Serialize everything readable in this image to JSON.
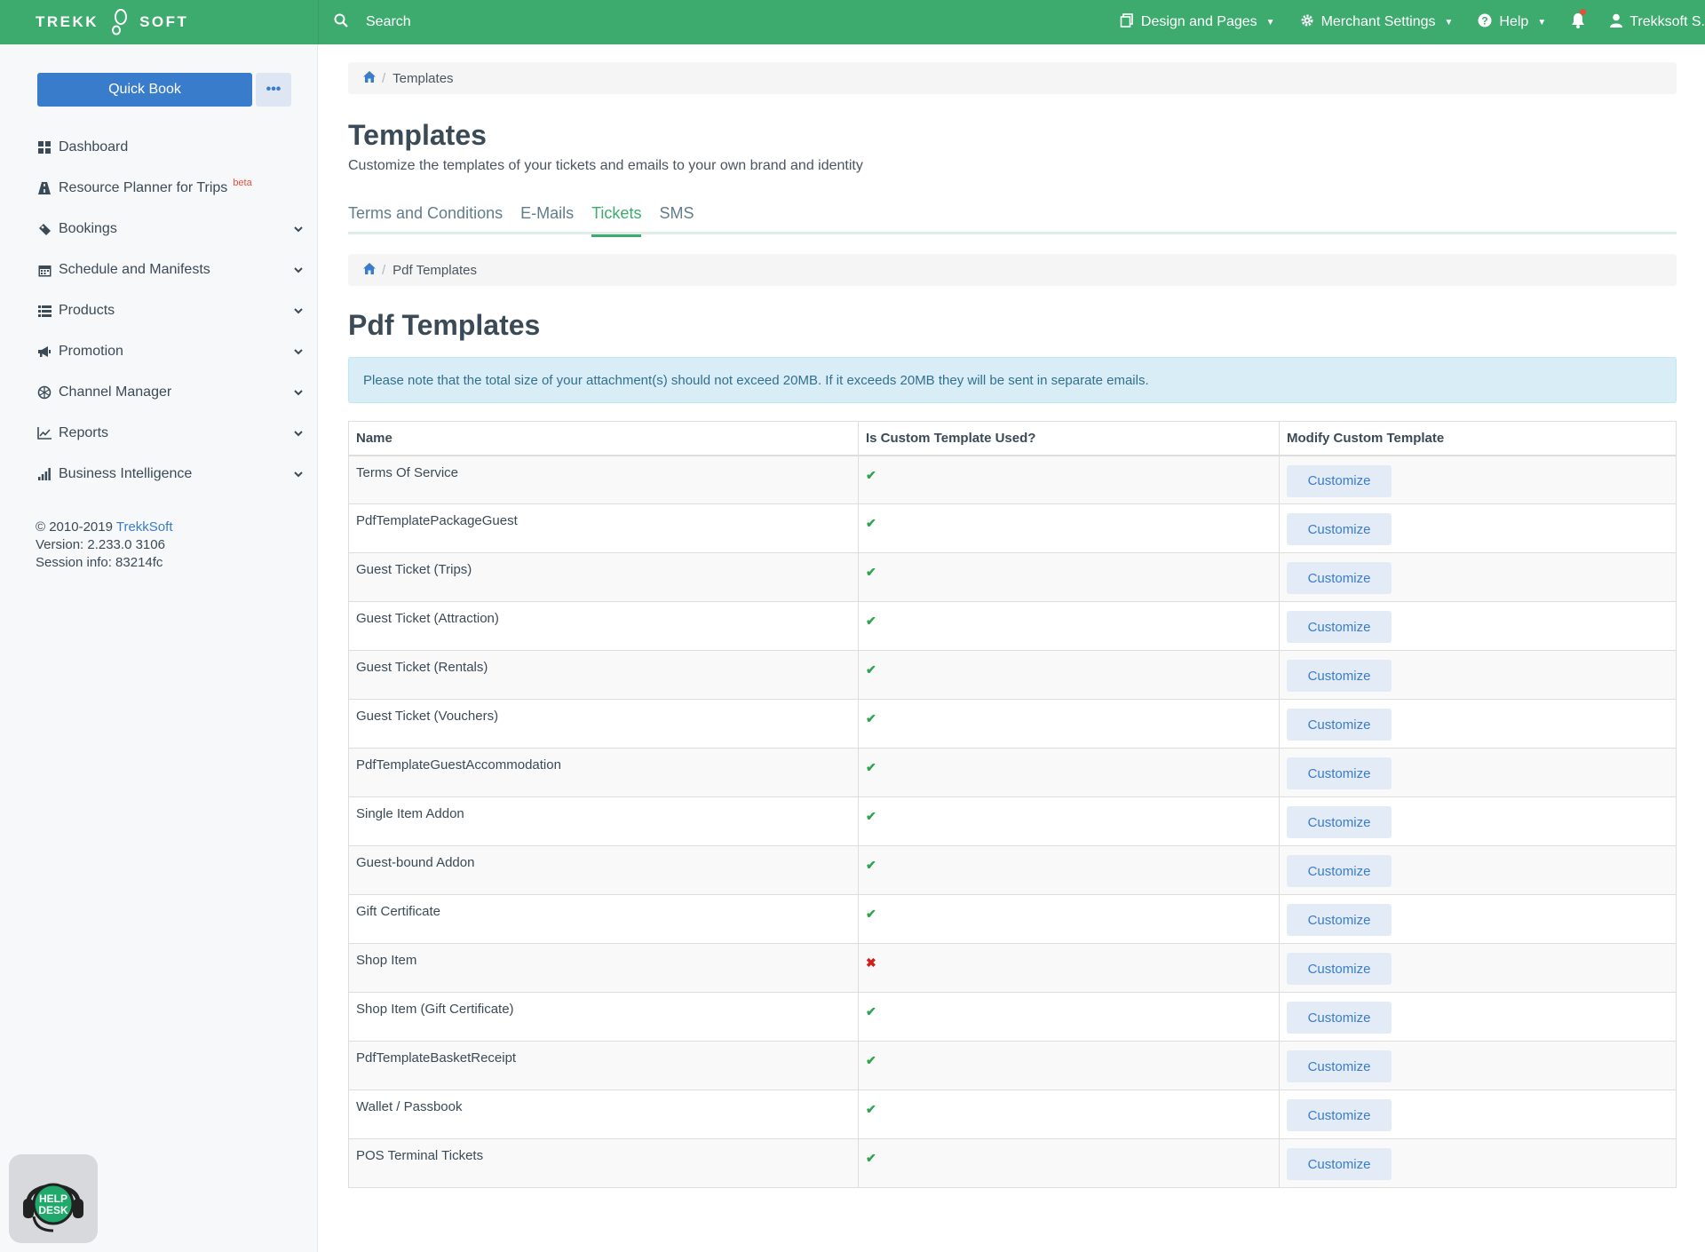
{
  "topbar": {
    "brand_left": "TREKK",
    "brand_right": "SOFT",
    "search_label": "Search",
    "design_label": "Design and Pages",
    "merchant_label": "Merchant Settings",
    "help_label": "Help",
    "user_label": "Trekksoft S."
  },
  "sidebar": {
    "quick_book": "Quick Book",
    "more": "•••",
    "items": [
      {
        "label": "Dashboard"
      },
      {
        "label": "Resource Planner for Trips",
        "badge": "beta"
      },
      {
        "label": "Bookings"
      },
      {
        "label": "Schedule and Manifests"
      },
      {
        "label": "Products"
      },
      {
        "label": "Promotion"
      },
      {
        "label": "Channel Manager"
      },
      {
        "label": "Reports"
      },
      {
        "label": "Business Intelligence"
      }
    ],
    "footer": {
      "copyright": "© 2010-2019 ",
      "company": "TrekkSoft",
      "version": "Version: 2.233.0 3106",
      "session": "Session info: 83214fc"
    },
    "helpdesk_line1": "HELP",
    "helpdesk_line2": "DESK"
  },
  "main": {
    "breadcrumb": "Templates",
    "title": "Templates",
    "subtitle": "Customize the templates of your tickets and emails to your own brand and identity",
    "tabs": [
      {
        "label": "Terms and Conditions"
      },
      {
        "label": "E-Mails"
      },
      {
        "label": "Tickets"
      },
      {
        "label": "SMS"
      }
    ],
    "breadcrumb2": "Pdf Templates",
    "section_title": "Pdf Templates",
    "alert": "Please note that the total size of your attachment(s) should not exceed 20MB. If it exceeds 20MB they will be sent in separate emails.",
    "table": {
      "headers": [
        "Name",
        "Is Custom Template Used?",
        "Modify Custom Template"
      ],
      "button_label": "Customize",
      "rows": [
        {
          "name": "Terms Of Service",
          "used": "✔"
        },
        {
          "name": "PdfTemplatePackageGuest",
          "used": "✔"
        },
        {
          "name": "Guest Ticket (Trips)",
          "used": "✔"
        },
        {
          "name": "Guest Ticket (Attraction)",
          "used": "✔"
        },
        {
          "name": "Guest Ticket (Rentals)",
          "used": "✔"
        },
        {
          "name": "Guest Ticket (Vouchers)",
          "used": "✔"
        },
        {
          "name": "PdfTemplateGuestAccommodation",
          "used": "✔"
        },
        {
          "name": "Single Item Addon",
          "used": "✔"
        },
        {
          "name": "Guest-bound Addon",
          "used": "✔"
        },
        {
          "name": "Gift Certificate",
          "used": "✔"
        },
        {
          "name": "Shop Item",
          "used": "✖"
        },
        {
          "name": "Shop Item (Gift Certificate)",
          "used": "✔"
        },
        {
          "name": "PdfTemplateBasketReceipt",
          "used": "✔"
        },
        {
          "name": "Wallet / Passbook",
          "used": "✔"
        },
        {
          "name": "POS Terminal Tickets",
          "used": "✔"
        }
      ]
    }
  },
  "colors": {
    "brand_green": "#3daa6e",
    "primary_blue": "#3a7ccc",
    "check_green": "#2ea44f",
    "cross_red": "#d0211c"
  }
}
